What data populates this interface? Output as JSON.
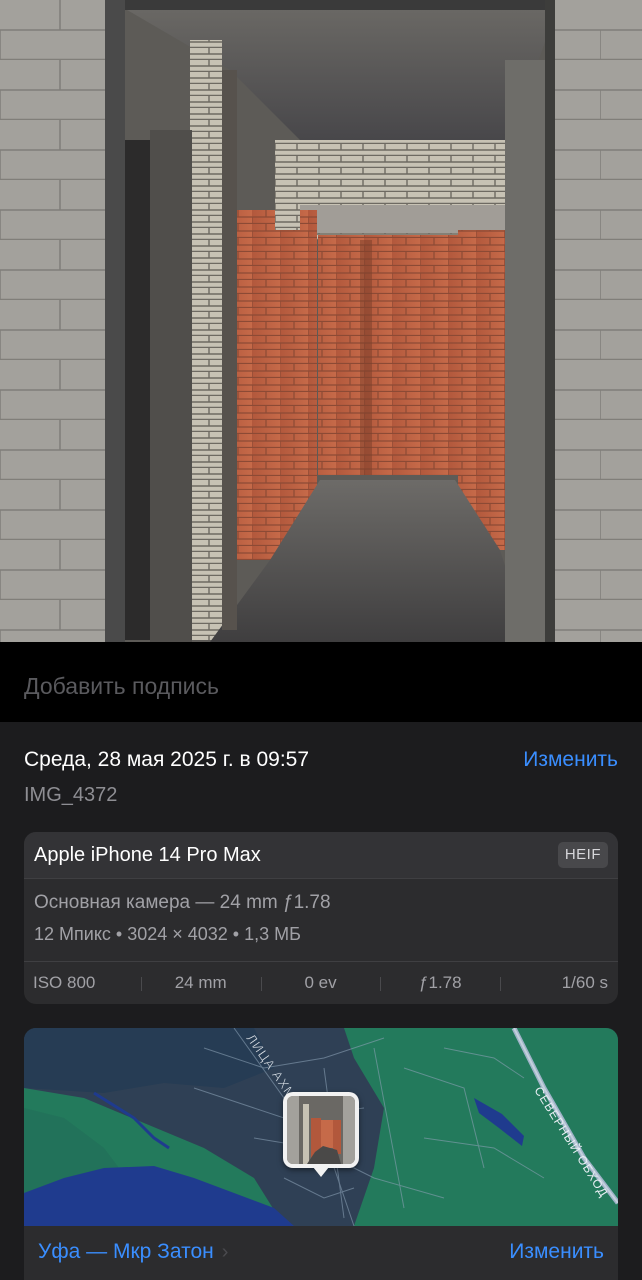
{
  "photo": {
    "description_icon": "photo-image"
  },
  "caption": {
    "placeholder": "Добавить подпись",
    "value": ""
  },
  "info": {
    "datetime": "Среда, 28 мая 2025 г. в 09:57",
    "edit_label": "Изменить",
    "filename": "IMG_4372"
  },
  "device": {
    "name": "Apple iPhone 14 Pro Max",
    "format": "HEIF",
    "camera": "Основная камера — 24 mm ƒ1.78",
    "specs": "12 Мпикс • 3024 × 4032 • 1,3 МБ",
    "exif": {
      "iso": "ISO 800",
      "focal": "24 mm",
      "ev": "0 ev",
      "aperture": "ƒ1.78",
      "shutter": "1/60 s"
    }
  },
  "map": {
    "street_label_1": "ЛИЦА АХМЕ",
    "street_label_2": "СЕВЕРНЫЙ ОБХОД",
    "location": "Уфа — Мкр Затон",
    "edit_label": "Изменить"
  },
  "colors": {
    "accent": "#3a8eff",
    "panel": "#1c1c1e",
    "card": "#2c2c2e",
    "map_green": "#237a5c",
    "map_water": "#1f3b8e"
  }
}
